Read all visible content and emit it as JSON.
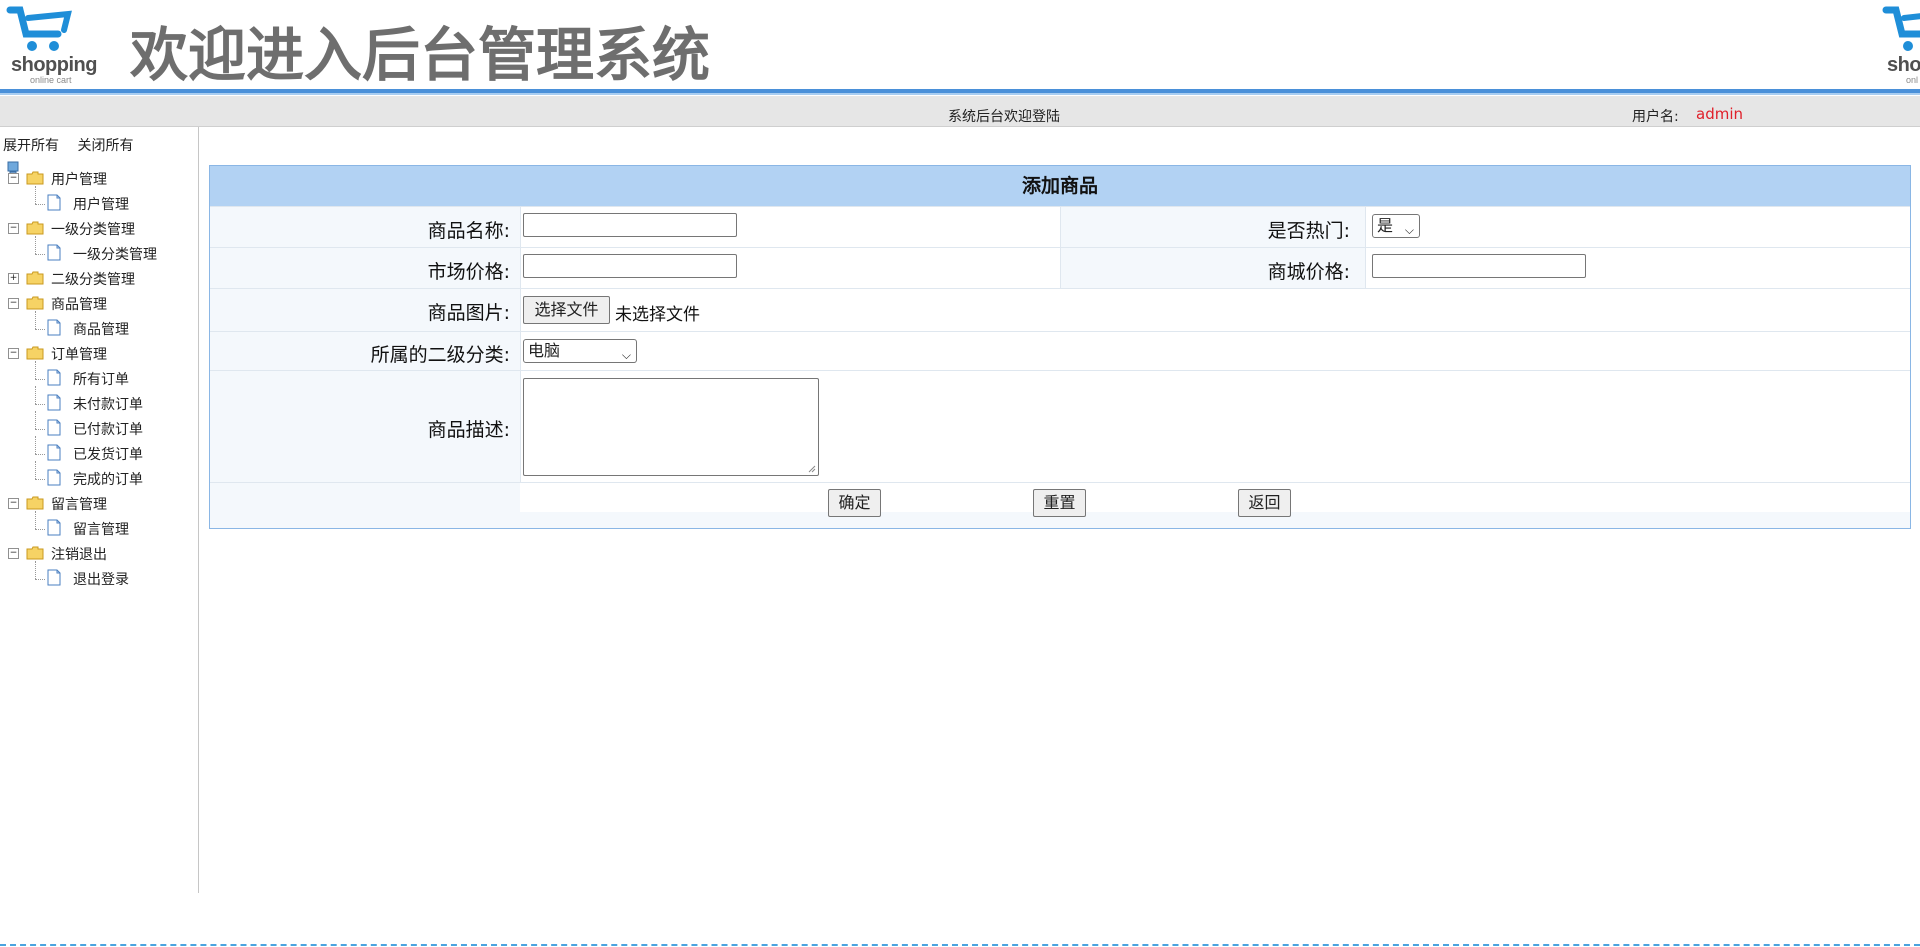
{
  "header": {
    "logo_text": "shopping",
    "logo_sub": "online cart",
    "title": "欢迎进入后台管理系统",
    "logo_right_text": "sho",
    "logo_right_sub": "onl"
  },
  "topbar": {
    "welcome": "系统后台欢迎登陆",
    "user_label": "用户名:",
    "user_name": "admin"
  },
  "sidebar": {
    "expand_all": "展开所有",
    "collapse_all": "关闭所有",
    "tree": [
      {
        "label": "用户管理",
        "expanded": true,
        "children": [
          "用户管理"
        ]
      },
      {
        "label": "一级分类管理",
        "expanded": true,
        "children": [
          "一级分类管理"
        ]
      },
      {
        "label": "二级分类管理",
        "expanded": false,
        "children": []
      },
      {
        "label": "商品管理",
        "expanded": true,
        "children": [
          "商品管理"
        ]
      },
      {
        "label": "订单管理",
        "expanded": true,
        "children": [
          "所有订单",
          "未付款订单",
          "已付款订单",
          "已发货订单",
          "完成的订单"
        ]
      },
      {
        "label": "留言管理",
        "expanded": true,
        "children": [
          "留言管理"
        ]
      },
      {
        "label": "注销退出",
        "expanded": true,
        "children": [
          "退出登录"
        ]
      }
    ]
  },
  "form": {
    "title": "添加商品",
    "product_name_label": "商品名称:",
    "product_name_value": "",
    "is_hot_label": "是否热门:",
    "is_hot_value": "是",
    "market_price_label": "市场价格:",
    "market_price_value": "",
    "shop_price_label": "商城价格:",
    "shop_price_value": "",
    "image_label": "商品图片:",
    "choose_file_label": "选择文件",
    "no_file_text": "未选择文件",
    "category_label": "所属的二级分类:",
    "category_value": "电脑",
    "description_label": "商品描述:",
    "description_value": "",
    "confirm_label": "确定",
    "reset_label": "重置",
    "back_label": "返回"
  },
  "colors": {
    "accent": "#4a90d9",
    "form_header": "#b2d2f3",
    "username": "#e0202a"
  }
}
